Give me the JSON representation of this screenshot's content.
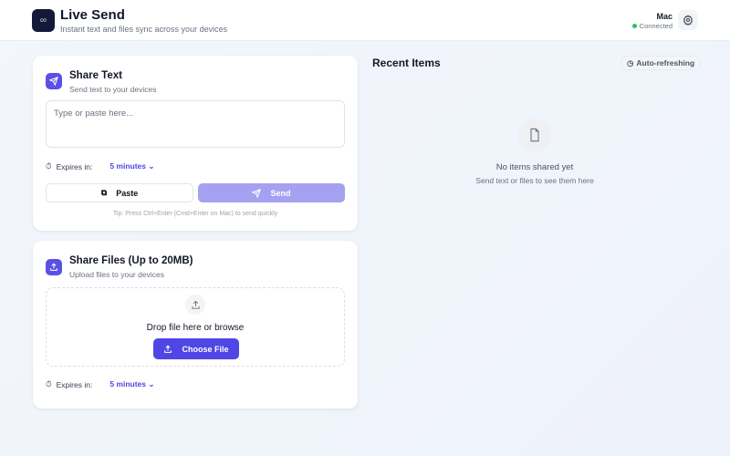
{
  "header": {
    "logo_symbol": "∞",
    "title": "Live Send",
    "subtitle": "Instant text and files sync across your devices",
    "device": "Mac",
    "status": "Connected",
    "status_color": "#22c55e"
  },
  "share_text": {
    "title": "Share Text",
    "subtitle": "Send text to your devices",
    "placeholder": "Type or paste here...",
    "expires_label": "Expires in:",
    "expires_value": "5 minutes",
    "paste_label": "Paste",
    "send_label": "Send",
    "tip": "Tip: Press Ctrl+Enter (Cmd+Enter on Mac) to send quickly"
  },
  "share_files": {
    "title": "Share Files (Up to 20MB)",
    "subtitle": "Upload files to your devices",
    "drop_text": "Drop file here or browse",
    "choose_label": "Choose File",
    "expires_label": "Expires in:",
    "expires_value": "5 minutes"
  },
  "recent": {
    "title": "Recent Items",
    "auto_label": "Auto-refreshing",
    "empty_title": "No items shared yet",
    "empty_sub": "Send text or files to see them here"
  },
  "colors": {
    "accent": "#4f46e5",
    "send_disabled": "#a5a1f0"
  }
}
